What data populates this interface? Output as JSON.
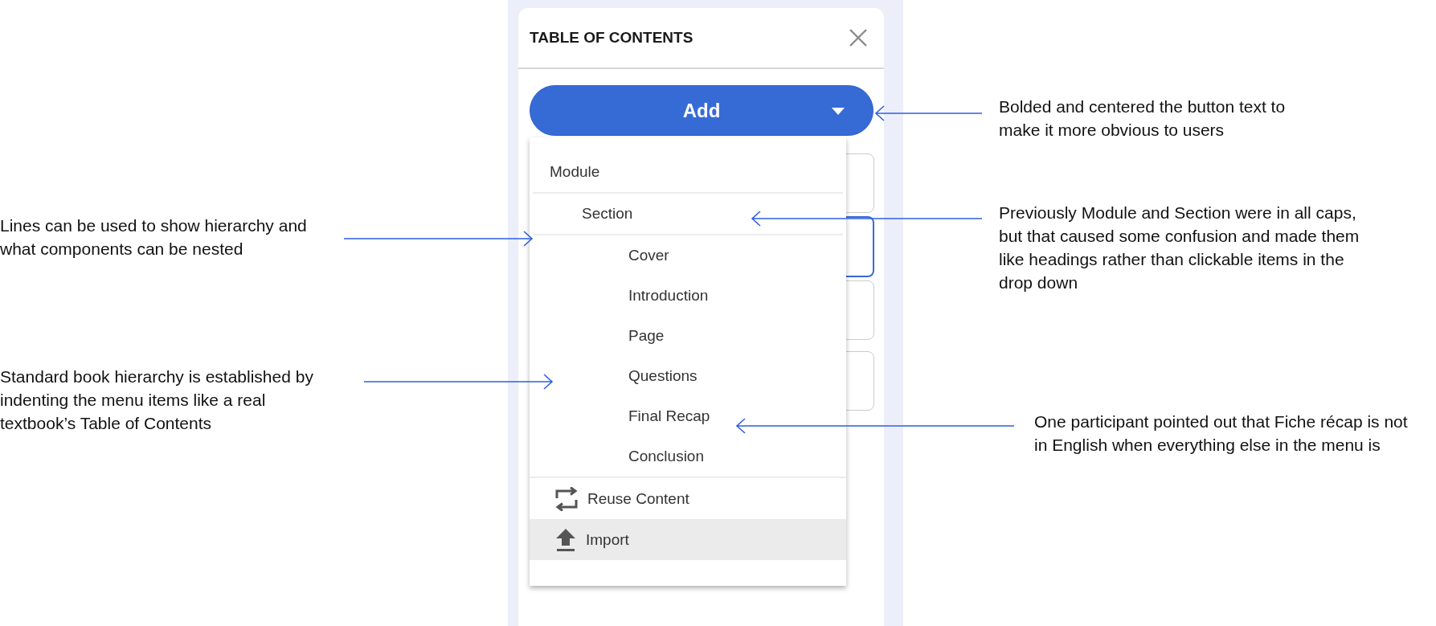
{
  "panel": {
    "title": "TABLE OF CONTENTS",
    "add_button": {
      "label": "Add"
    },
    "menu": {
      "items": [
        {
          "label": "Module",
          "children": [
            {
              "label": "Section",
              "children": [
                {
                  "label": "Cover"
                },
                {
                  "label": "Introduction"
                },
                {
                  "label": "Page"
                },
                {
                  "label": "Questions"
                },
                {
                  "label": "Final Recap"
                },
                {
                  "label": "Conclusion"
                }
              ]
            }
          ]
        }
      ],
      "actions": [
        {
          "label": "Reuse Content",
          "kind": "reuse",
          "highlighted": false
        },
        {
          "label": "Import",
          "kind": "import",
          "highlighted": true
        }
      ]
    },
    "fields": [
      {
        "focused": false
      },
      {
        "focused": true
      },
      {
        "focused": false
      },
      {
        "focused": false
      }
    ]
  },
  "annotations": [
    {
      "text": "Lines can be used to show hierarchy and what components can be nested"
    },
    {
      "text": "Standard book hierarchy is established by indenting the menu items like a real textbook’s Table of Contents"
    },
    {
      "text": "Bolded and centered the button text to make it more obvious to users"
    },
    {
      "text": "Previously Module and Section were in all caps, but that caused some confusion and made them like headings rather than clickable items in the drop down"
    },
    {
      "text": "One participant pointed out that Fiche récap is not in English when everything else in the menu is"
    }
  ]
}
